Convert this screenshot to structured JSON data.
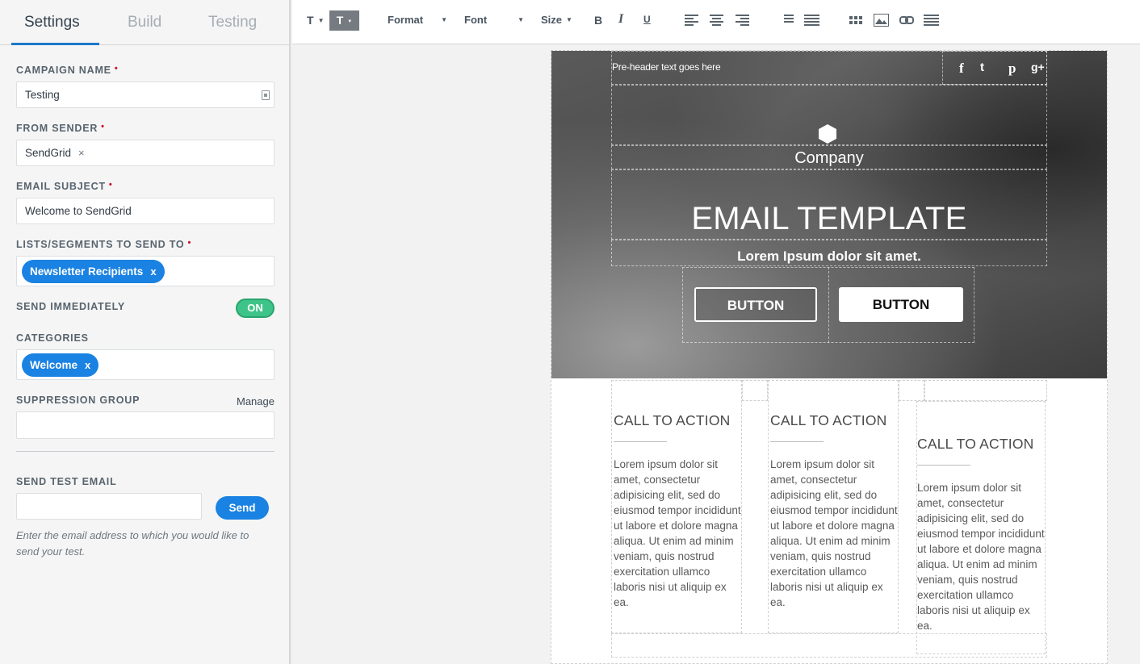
{
  "tabs": [
    {
      "label": "Settings",
      "active": true
    },
    {
      "label": "Build",
      "active": false
    },
    {
      "label": "Testing",
      "active": false
    }
  ],
  "settings": {
    "campaign_name": {
      "label": "CAMPAIGN NAME",
      "value": "Testing"
    },
    "from_sender": {
      "label": "FROM SENDER",
      "value": "SendGrid",
      "remove": "×"
    },
    "email_subject": {
      "label": "EMAIL SUBJECT",
      "value": "Welcome to SendGrid"
    },
    "lists": {
      "label": "LISTS/SEGMENTS TO SEND TO",
      "tag": "Newsletter Recipients",
      "remove": "x"
    },
    "send_immediately": {
      "label": "SEND IMMEDIATELY",
      "toggle": "ON"
    },
    "categories": {
      "label": "CATEGORIES",
      "tag": "Welcome",
      "remove": "x"
    },
    "suppression": {
      "label": "SUPPRESSION GROUP",
      "manage": "Manage"
    },
    "test_email": {
      "label": "SEND TEST EMAIL",
      "button": "Send",
      "help": "Enter the email address to which you would like to send your test."
    },
    "required_mark": "•"
  },
  "toolbar": {
    "text_btn_1": "T",
    "text_btn_2": "T",
    "format": "Format",
    "font": "Font",
    "size": "Size",
    "bold": "B",
    "italic": "I",
    "underline": "U",
    "caret": "▼"
  },
  "email": {
    "preheader": "Pre-header text goes here",
    "social": [
      "f",
      "t",
      "p",
      "g+"
    ],
    "company": "Company",
    "title": "EMAIL TEMPLATE",
    "subtitle": "Lorem Ipsum dolor sit amet.",
    "button_1": "BUTTON",
    "button_2": "BUTTON",
    "ctas": [
      {
        "title": "CALL TO ACTION",
        "body": "Lorem ipsum dolor sit amet, consectetur adipisicing elit, sed do eiusmod tempor incididunt ut labore et dolore magna aliqua. Ut enim ad minim veniam, quis nostrud exercitation ullamco laboris nisi ut aliquip ex ea."
      },
      {
        "title": "CALL TO ACTION",
        "body": "Lorem ipsum dolor sit amet, consectetur adipisicing elit, sed do eiusmod tempor incididunt ut labore et dolore magna aliqua. Ut enim ad minim veniam, quis nostrud exercitation ullamco laboris nisi ut aliquip ex ea."
      },
      {
        "title": "CALL TO ACTION",
        "body": "Lorem ipsum dolor sit amet, consectetur adipisicing elit, sed do eiusmod tempor incididunt ut labore et dolore magna aliqua. Ut enim ad minim veniam, quis nostrud exercitation ullamco laboris nisi ut aliquip ex ea."
      }
    ]
  },
  "colors": {
    "accent": "#1a82e2",
    "toggle_on": "#3ec488",
    "required": "#c8102e"
  }
}
